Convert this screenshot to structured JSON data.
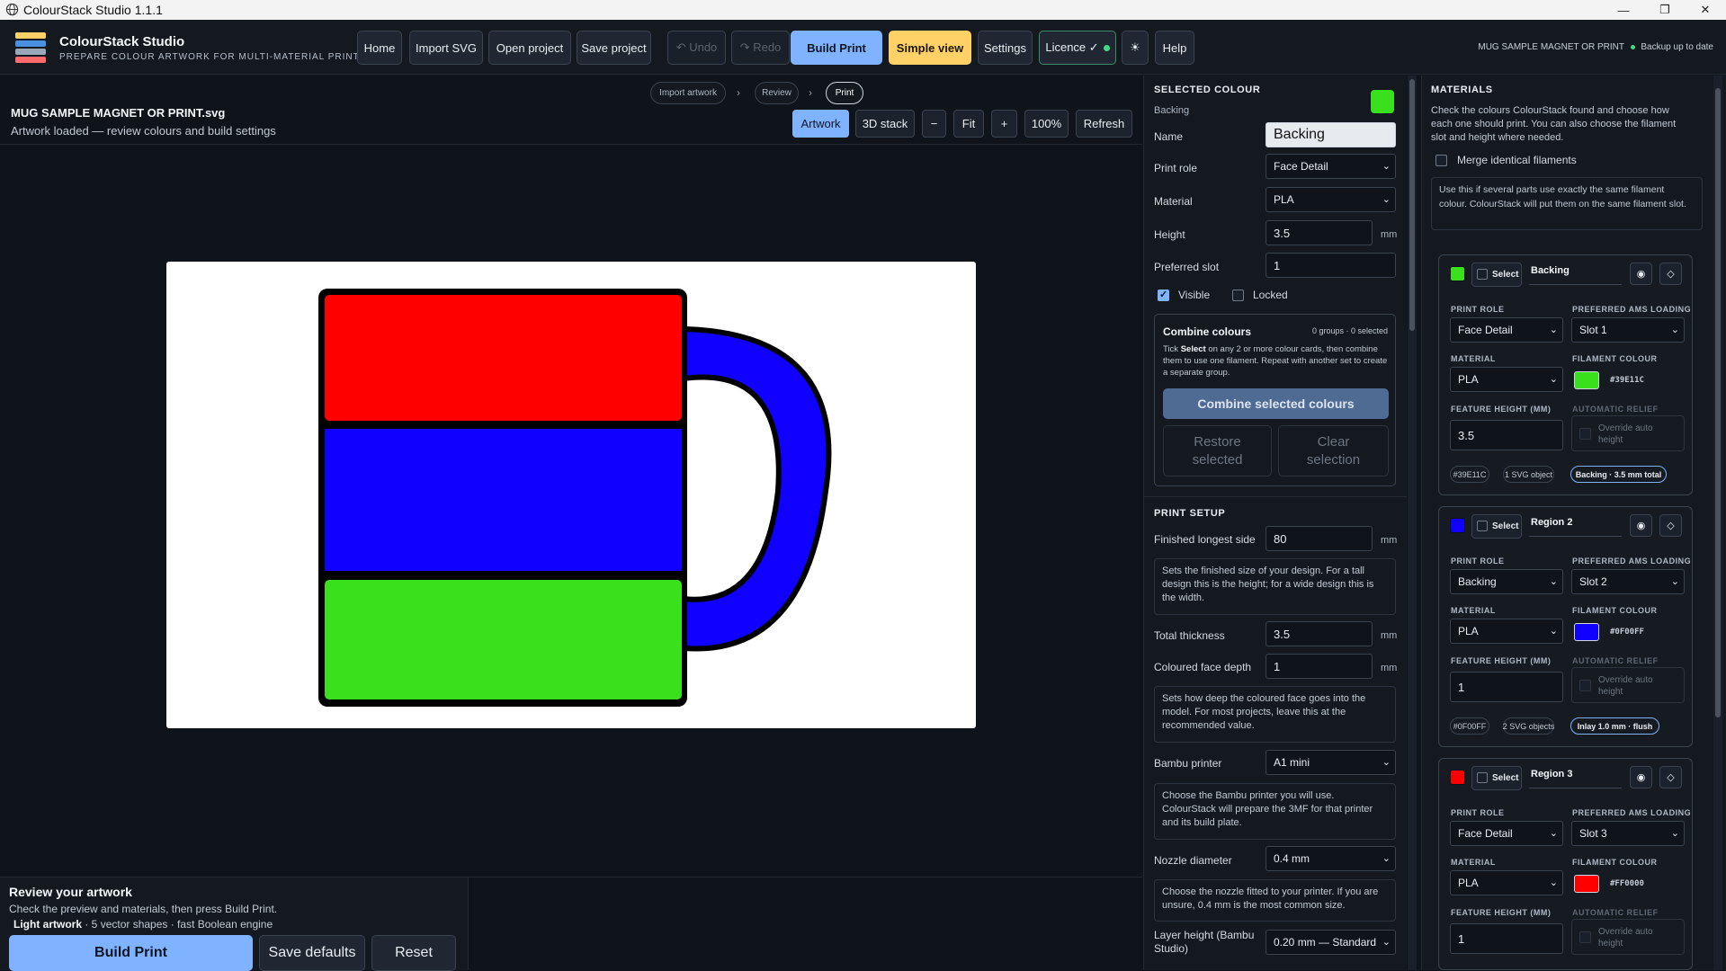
{
  "window": {
    "title": "ColourStack Studio 1.1.1"
  },
  "app": {
    "name": "ColourStack Studio",
    "subtitle": "PREPARE COLOUR ARTWORK FOR MULTI-MATERIAL PRINTING"
  },
  "toolbar": {
    "home": "Home",
    "import_svg": "Import SVG",
    "open_project": "Open project",
    "save_project": "Save project",
    "undo": "↶ Undo",
    "redo": "↷ Redo",
    "build_print": "Build Print",
    "simple_view": "Simple view",
    "settings": "Settings",
    "licence": "Licence ✓",
    "theme_icon": "☀",
    "help": "Help"
  },
  "status": {
    "project": "MUG SAMPLE MAGNET OR PRINT",
    "backup": "Backup up to date"
  },
  "steps": [
    "Import artwork",
    "Review",
    "Print"
  ],
  "document": {
    "title": "MUG SAMPLE MAGNET OR PRINT.svg",
    "subtitle": "Artwork loaded — review colours and build settings"
  },
  "view": {
    "artwork": "Artwork",
    "stack": "3D stack",
    "zoom_out": "−",
    "fit": "Fit",
    "zoom_in": "+",
    "zoom": "100%",
    "refresh": "Refresh"
  },
  "artwork_colors": {
    "top": "#FF0000",
    "middle": "#0F00FF",
    "bottom": "#39E11C",
    "handle": "#0F00FF"
  },
  "bottom": {
    "title": "Review your artwork",
    "subtitle": "Check the preview and materials, then press Build Print.",
    "info_bold": "Light artwork",
    "info_rest": " · 5 vector shapes · fast Boolean engine",
    "build": "Build Print",
    "save_defaults": "Save defaults",
    "reset": "Reset"
  },
  "selected": {
    "section": "SELECTED COLOUR",
    "name_caption": "Backing",
    "swatch": "#39E11C",
    "name_label": "Name",
    "name_value": "Backing",
    "role_label": "Print role",
    "role_value": "Face Detail",
    "material_label": "Material",
    "material_value": "PLA",
    "height_label": "Height",
    "height_value": "3.5",
    "height_unit": "mm",
    "slot_label": "Preferred slot",
    "slot_value": "1",
    "visible": "Visible",
    "locked": "Locked"
  },
  "combine": {
    "title": "Combine colours",
    "count": "0 groups · 0 selected",
    "help_pre": "Tick ",
    "help_bold": "Select",
    "help_post": " on any 2 or more colour cards, then combine them to use one filament. Repeat with another set to create a separate group.",
    "combine_btn": "Combine selected colours",
    "restore": "Restore selected",
    "clear": "Clear selection"
  },
  "setup": {
    "section": "PRINT SETUP",
    "longest_label": "Finished longest side",
    "longest_value": "80",
    "unit": "mm",
    "longest_note": "Sets the finished size of your design. For a tall design this is the height; for a wide design this is the width.",
    "thickness_label": "Total thickness",
    "thickness_value": "3.5",
    "face_label": "Coloured face depth",
    "face_value": "1",
    "face_note": "Sets how deep the coloured face goes into the model. For most projects, leave this at the recommended value.",
    "printer_label": "Bambu printer",
    "printer_value": "A1 mini",
    "printer_note": "Choose the Bambu printer you will use. ColourStack will prepare the 3MF for that printer and its build plate.",
    "nozzle_label": "Nozzle diameter",
    "nozzle_value": "0.4 mm",
    "nozzle_note": "Choose the nozzle fitted to your printer. If you are unsure, 0.4 mm is the most common size.",
    "layer_label": "Layer height (Bambu Studio)",
    "layer_value": "0.20 mm — Standard"
  },
  "materials": {
    "section": "MATERIALS",
    "intro": "Check the colours ColourStack found and choose how each one should print. You can also choose the filament slot and height where needed.",
    "merge": "Merge identical filaments",
    "merge_note": "Use this if several parts use exactly the same filament colour. ColourStack will put them on the same filament slot.",
    "labels": {
      "role": "PRINT ROLE",
      "ams": "PREFERRED AMS LOADING",
      "material": "MATERIAL",
      "filament": "FILAMENT COLOUR",
      "feature": "FEATURE HEIGHT (MM)",
      "relief": "AUTOMATIC RELIEF",
      "override": "Override auto height",
      "select": "Select"
    },
    "cards": [
      {
        "name": "Backing",
        "color": "#39E11C",
        "role": "Face Detail",
        "slot": "Slot 1",
        "material": "PLA",
        "hex": "#39E11C",
        "height": "3.5",
        "chip1": "#39E11C",
        "chip2": "1 SVG object",
        "chip3": "Backing · 3.5 mm total"
      },
      {
        "name": "Region 2",
        "color": "#0F00FF",
        "role": "Backing",
        "slot": "Slot 2",
        "material": "PLA",
        "hex": "#0F00FF",
        "height": "1",
        "chip1": "#0F00FF",
        "chip2": "2 SVG objects",
        "chip3": "Inlay 1.0 mm · flush"
      },
      {
        "name": "Region 3",
        "color": "#FF0000",
        "role": "Face Detail",
        "slot": "Slot 3",
        "material": "PLA",
        "hex": "#FF0000",
        "height": "1"
      }
    ]
  }
}
